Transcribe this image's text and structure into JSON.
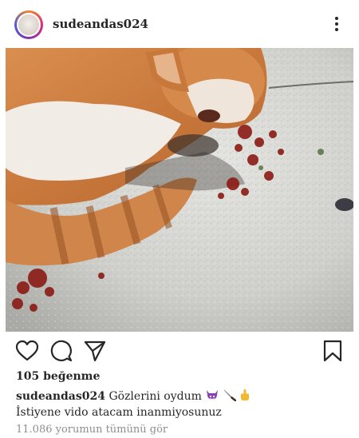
{
  "post": {
    "username": "sudeandas024",
    "likes_text": "105 beğenme",
    "caption_user": "sudeandas024",
    "caption_text": "Gözlerini oydum",
    "caption_emojis": [
      "imp-emoji",
      "knife-emoji",
      "middle-finger-emoji"
    ],
    "caption_line2": "İstiyene vido atacam inanmiyosunuz",
    "comments_link": "11.086 yorumun tümünü gör"
  },
  "icons": {
    "more": "more-options-icon",
    "like": "heart-icon",
    "comment": "comment-icon",
    "share": "paper-plane-icon",
    "save": "bookmark-icon"
  },
  "colors": {
    "text": "#262626",
    "muted": "#8e8e8e",
    "avatar_ring": [
      "#f58529",
      "#dd2a7b",
      "#8134af",
      "#515bd4"
    ],
    "emoji_purple": "#8b3fb0"
  }
}
